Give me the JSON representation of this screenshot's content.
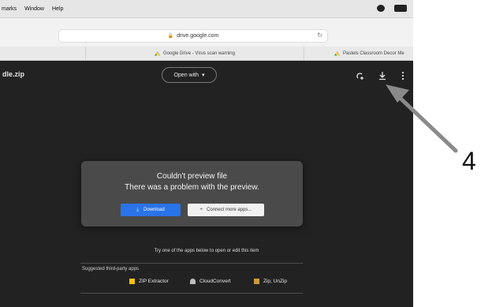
{
  "menubar": {
    "items": [
      "marks",
      "Window",
      "Help"
    ]
  },
  "browser": {
    "url": "drive.google.com",
    "tabs": [
      "Google Drive - Virus scan warning",
      "Pastels Classroom Decor Me"
    ]
  },
  "viewer": {
    "filename": "dle.zip",
    "open_with_label": "Open with",
    "error_title": "Couldn't preview file",
    "error_message": "There was a problem with the preview.",
    "download_label": "Download",
    "connect_label": "Connect more apps...",
    "try_text": "Try one of the apps below to open or edit this item",
    "suggested_label": "Suggested third-party apps",
    "apps": [
      "ZIP Extractor",
      "CloudConvert",
      "Zip, UnZip"
    ]
  },
  "annotation": {
    "number": "4"
  },
  "colors": {
    "viewer_bg": "#222222",
    "card_bg": "#4a4a4a",
    "download_blue": "#2a73e8",
    "arrow_gray": "#8a8a8a"
  }
}
